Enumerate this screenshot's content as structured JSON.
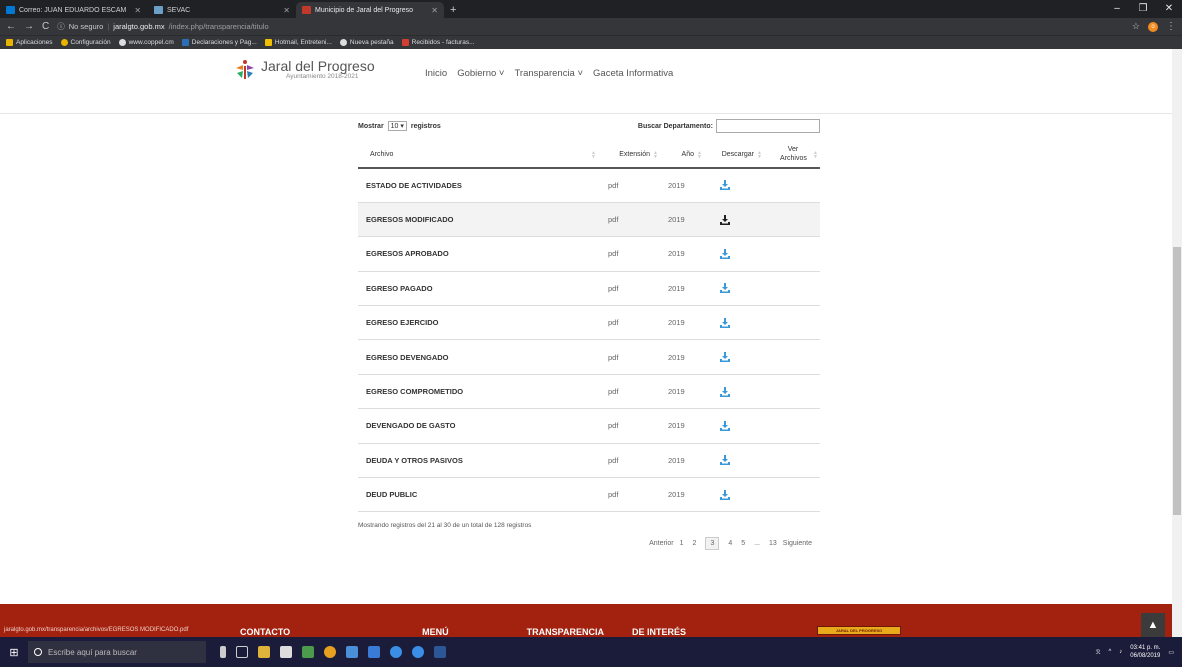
{
  "browser": {
    "tabs": [
      {
        "title": "Correo: JUAN EDUARDO ESCAM",
        "color": "#0078d4"
      },
      {
        "title": "SEVAC",
        "color": "#6aa0c8"
      },
      {
        "title": "Municipio de Jaral del Progreso",
        "color": "#c0392b"
      }
    ],
    "window_controls": {
      "minimize": "–",
      "maximize": "❐",
      "close": "✕"
    },
    "address": {
      "security": "No seguro",
      "domain": "jaralgto.gob.mx",
      "path": "/index.php/transparencia/titulo"
    },
    "bookmarks": [
      {
        "label": "Aplicaciones",
        "color": "#e8b400"
      },
      {
        "label": "Configuración",
        "color": "#e8b400"
      },
      {
        "label": "www.coppel.cm",
        "color": "#dddddd"
      },
      {
        "label": "Declaraciones y Pag...",
        "color": "#2a6fb5"
      },
      {
        "label": "Hotmail, Entreteni...",
        "color": "#f0c000"
      },
      {
        "label": "Nueva pestaña",
        "color": "#dddddd"
      },
      {
        "label": "Recibidos - facturas...",
        "color": "#d23f31"
      }
    ]
  },
  "site": {
    "logo_name": "Jaral del Progreso",
    "logo_sub": "Ayuntamiento 2018-2021",
    "menu": [
      "Inicio",
      "Gobierno ˅",
      "Transparencia ˅",
      "Gaceta Informativa"
    ]
  },
  "table_controls": {
    "show_label": "Mostrar",
    "show_value": "10 ▾",
    "show_suffix": "registros",
    "search_label": "Buscar Departamento:",
    "search_value": ""
  },
  "table": {
    "headers": {
      "archivo": "Archivo",
      "extension": "Extensión",
      "anio": "Año",
      "descargar": "Descargar",
      "ver": "Ver Archivos"
    },
    "rows": [
      {
        "archivo": "ESTADO DE ACTIVIDADES",
        "extension": "pdf",
        "anio": "2019"
      },
      {
        "archivo": "EGRESOS MODIFICADO",
        "extension": "pdf",
        "anio": "2019"
      },
      {
        "archivo": "EGRESOS APROBADO",
        "extension": "pdf",
        "anio": "2019"
      },
      {
        "archivo": "EGRESO PAGADO",
        "extension": "pdf",
        "anio": "2019"
      },
      {
        "archivo": "EGRESO EJERCIDO",
        "extension": "pdf",
        "anio": "2019"
      },
      {
        "archivo": "EGRESO DEVENGADO",
        "extension": "pdf",
        "anio": "2019"
      },
      {
        "archivo": "EGRESO COMPROMETIDO",
        "extension": "pdf",
        "anio": "2019"
      },
      {
        "archivo": "DEVENGADO DE GASTO",
        "extension": "pdf",
        "anio": "2019"
      },
      {
        "archivo": "DEUDA Y OTROS PASIVOS",
        "extension": "pdf",
        "anio": "2019"
      },
      {
        "archivo": "DEUD PUBLIC",
        "extension": "pdf",
        "anio": "2019"
      }
    ]
  },
  "colors": {
    "download_icon": "#3a9ad9",
    "download_icon_hover": "#222222",
    "footer_bg": "#a3210f"
  },
  "info_text": "Mostrando registros del 21 al 30 de un total de 128 registros",
  "pagination": {
    "prev": "Anterior",
    "pages": [
      "1",
      "2",
      "3",
      "4",
      "5",
      "...",
      "13"
    ],
    "current": "3",
    "next": "Siguiente"
  },
  "footer": {
    "links": [
      "CONTACTO",
      "MENÚ",
      "TRANSPARENCIA",
      "DE INTERÉS"
    ],
    "banner": "JARAL DEL PROGRESO",
    "status_url": "jaralgto.gob.mx/transparencia/archivos/EGRESOS MODIFICADO.pdf"
  },
  "taskbar": {
    "search_placeholder": "Escribe aquí para buscar",
    "time": "03:41 p. m.",
    "date": "06/08/2019"
  }
}
